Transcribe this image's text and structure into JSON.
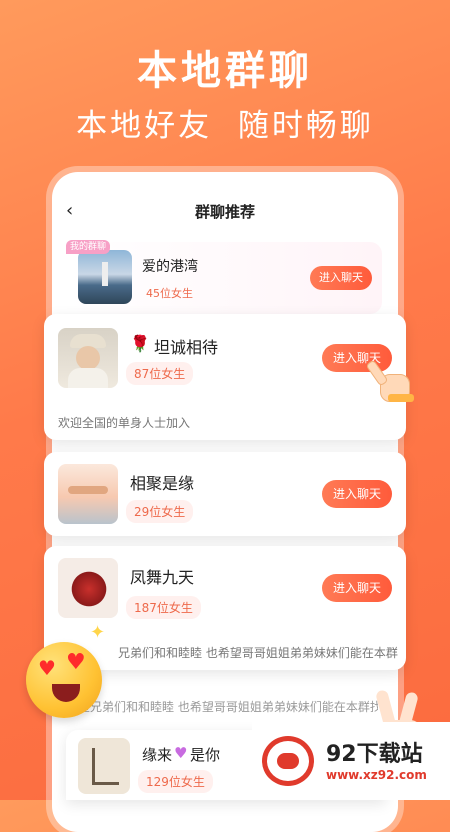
{
  "hero": {
    "title": "本地群聊",
    "subtitle": "本地好友  随时畅聊"
  },
  "nav": {
    "back_icon": "‹",
    "title": "群聊推荐"
  },
  "my_group_badge": "我的群聊",
  "groups": [
    {
      "name": "爱的港湾",
      "count": "45位女生",
      "button": "进入聊天"
    },
    {
      "emoji": "🌹",
      "name": "坦诚相待",
      "count": "87位女生",
      "button": "进入聊天",
      "desc": "欢迎全国的单身人士加入"
    },
    {
      "name": "相聚是缘",
      "count": "29位女生",
      "button": "进入聊天"
    },
    {
      "name": "凤舞九天",
      "count": "187位女生",
      "button": "进入聊天",
      "desc": "兄弟们和和睦睦 也希望哥哥姐姐弟弟妹妹们能在本群找..."
    },
    {
      "desc": "望兄弟们和和睦睦 也希望哥哥姐姐弟弟妹妹们能在本群找..."
    },
    {
      "name_a": "缘来",
      "name_b": "是你",
      "count": "129位女生"
    }
  ],
  "watermark": {
    "name": "92下载站",
    "url": "www.xz92.com"
  },
  "colors": {
    "accent": "#ff6a45",
    "badge": "#f7a0c6"
  }
}
